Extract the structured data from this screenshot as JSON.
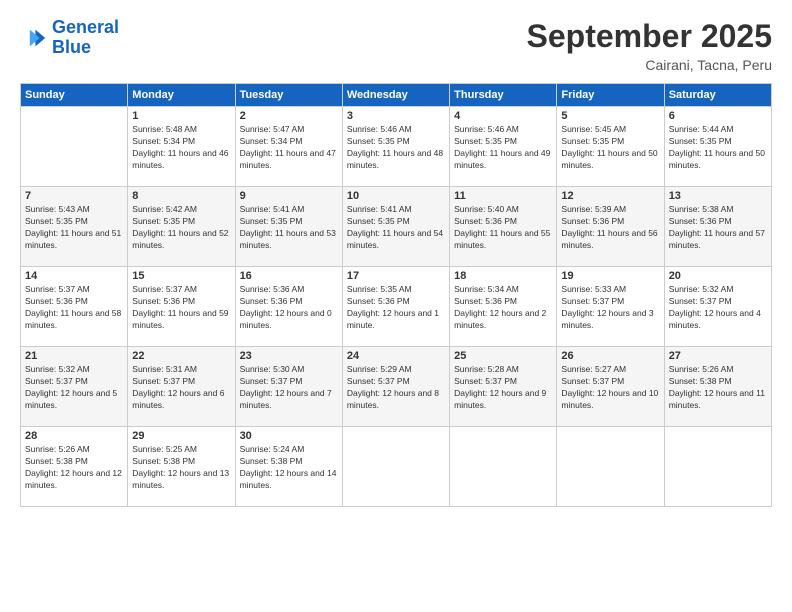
{
  "logo": {
    "line1": "General",
    "line2": "Blue"
  },
  "title": "September 2025",
  "subtitle": "Cairani, Tacna, Peru",
  "header": {
    "days": [
      "Sunday",
      "Monday",
      "Tuesday",
      "Wednesday",
      "Thursday",
      "Friday",
      "Saturday"
    ]
  },
  "weeks": [
    [
      {
        "num": "",
        "sunrise": "",
        "sunset": "",
        "daylight": ""
      },
      {
        "num": "1",
        "sunrise": "Sunrise: 5:48 AM",
        "sunset": "Sunset: 5:34 PM",
        "daylight": "Daylight: 11 hours and 46 minutes."
      },
      {
        "num": "2",
        "sunrise": "Sunrise: 5:47 AM",
        "sunset": "Sunset: 5:34 PM",
        "daylight": "Daylight: 11 hours and 47 minutes."
      },
      {
        "num": "3",
        "sunrise": "Sunrise: 5:46 AM",
        "sunset": "Sunset: 5:35 PM",
        "daylight": "Daylight: 11 hours and 48 minutes."
      },
      {
        "num": "4",
        "sunrise": "Sunrise: 5:46 AM",
        "sunset": "Sunset: 5:35 PM",
        "daylight": "Daylight: 11 hours and 49 minutes."
      },
      {
        "num": "5",
        "sunrise": "Sunrise: 5:45 AM",
        "sunset": "Sunset: 5:35 PM",
        "daylight": "Daylight: 11 hours and 50 minutes."
      },
      {
        "num": "6",
        "sunrise": "Sunrise: 5:44 AM",
        "sunset": "Sunset: 5:35 PM",
        "daylight": "Daylight: 11 hours and 50 minutes."
      }
    ],
    [
      {
        "num": "7",
        "sunrise": "Sunrise: 5:43 AM",
        "sunset": "Sunset: 5:35 PM",
        "daylight": "Daylight: 11 hours and 51 minutes."
      },
      {
        "num": "8",
        "sunrise": "Sunrise: 5:42 AM",
        "sunset": "Sunset: 5:35 PM",
        "daylight": "Daylight: 11 hours and 52 minutes."
      },
      {
        "num": "9",
        "sunrise": "Sunrise: 5:41 AM",
        "sunset": "Sunset: 5:35 PM",
        "daylight": "Daylight: 11 hours and 53 minutes."
      },
      {
        "num": "10",
        "sunrise": "Sunrise: 5:41 AM",
        "sunset": "Sunset: 5:35 PM",
        "daylight": "Daylight: 11 hours and 54 minutes."
      },
      {
        "num": "11",
        "sunrise": "Sunrise: 5:40 AM",
        "sunset": "Sunset: 5:36 PM",
        "daylight": "Daylight: 11 hours and 55 minutes."
      },
      {
        "num": "12",
        "sunrise": "Sunrise: 5:39 AM",
        "sunset": "Sunset: 5:36 PM",
        "daylight": "Daylight: 11 hours and 56 minutes."
      },
      {
        "num": "13",
        "sunrise": "Sunrise: 5:38 AM",
        "sunset": "Sunset: 5:36 PM",
        "daylight": "Daylight: 11 hours and 57 minutes."
      }
    ],
    [
      {
        "num": "14",
        "sunrise": "Sunrise: 5:37 AM",
        "sunset": "Sunset: 5:36 PM",
        "daylight": "Daylight: 11 hours and 58 minutes."
      },
      {
        "num": "15",
        "sunrise": "Sunrise: 5:37 AM",
        "sunset": "Sunset: 5:36 PM",
        "daylight": "Daylight: 11 hours and 59 minutes."
      },
      {
        "num": "16",
        "sunrise": "Sunrise: 5:36 AM",
        "sunset": "Sunset: 5:36 PM",
        "daylight": "Daylight: 12 hours and 0 minutes."
      },
      {
        "num": "17",
        "sunrise": "Sunrise: 5:35 AM",
        "sunset": "Sunset: 5:36 PM",
        "daylight": "Daylight: 12 hours and 1 minute."
      },
      {
        "num": "18",
        "sunrise": "Sunrise: 5:34 AM",
        "sunset": "Sunset: 5:36 PM",
        "daylight": "Daylight: 12 hours and 2 minutes."
      },
      {
        "num": "19",
        "sunrise": "Sunrise: 5:33 AM",
        "sunset": "Sunset: 5:37 PM",
        "daylight": "Daylight: 12 hours and 3 minutes."
      },
      {
        "num": "20",
        "sunrise": "Sunrise: 5:32 AM",
        "sunset": "Sunset: 5:37 PM",
        "daylight": "Daylight: 12 hours and 4 minutes."
      }
    ],
    [
      {
        "num": "21",
        "sunrise": "Sunrise: 5:32 AM",
        "sunset": "Sunset: 5:37 PM",
        "daylight": "Daylight: 12 hours and 5 minutes."
      },
      {
        "num": "22",
        "sunrise": "Sunrise: 5:31 AM",
        "sunset": "Sunset: 5:37 PM",
        "daylight": "Daylight: 12 hours and 6 minutes."
      },
      {
        "num": "23",
        "sunrise": "Sunrise: 5:30 AM",
        "sunset": "Sunset: 5:37 PM",
        "daylight": "Daylight: 12 hours and 7 minutes."
      },
      {
        "num": "24",
        "sunrise": "Sunrise: 5:29 AM",
        "sunset": "Sunset: 5:37 PM",
        "daylight": "Daylight: 12 hours and 8 minutes."
      },
      {
        "num": "25",
        "sunrise": "Sunrise: 5:28 AM",
        "sunset": "Sunset: 5:37 PM",
        "daylight": "Daylight: 12 hours and 9 minutes."
      },
      {
        "num": "26",
        "sunrise": "Sunrise: 5:27 AM",
        "sunset": "Sunset: 5:37 PM",
        "daylight": "Daylight: 12 hours and 10 minutes."
      },
      {
        "num": "27",
        "sunrise": "Sunrise: 5:26 AM",
        "sunset": "Sunset: 5:38 PM",
        "daylight": "Daylight: 12 hours and 11 minutes."
      }
    ],
    [
      {
        "num": "28",
        "sunrise": "Sunrise: 5:26 AM",
        "sunset": "Sunset: 5:38 PM",
        "daylight": "Daylight: 12 hours and 12 minutes."
      },
      {
        "num": "29",
        "sunrise": "Sunrise: 5:25 AM",
        "sunset": "Sunset: 5:38 PM",
        "daylight": "Daylight: 12 hours and 13 minutes."
      },
      {
        "num": "30",
        "sunrise": "Sunrise: 5:24 AM",
        "sunset": "Sunset: 5:38 PM",
        "daylight": "Daylight: 12 hours and 14 minutes."
      },
      {
        "num": "",
        "sunrise": "",
        "sunset": "",
        "daylight": ""
      },
      {
        "num": "",
        "sunrise": "",
        "sunset": "",
        "daylight": ""
      },
      {
        "num": "",
        "sunrise": "",
        "sunset": "",
        "daylight": ""
      },
      {
        "num": "",
        "sunrise": "",
        "sunset": "",
        "daylight": ""
      }
    ]
  ]
}
